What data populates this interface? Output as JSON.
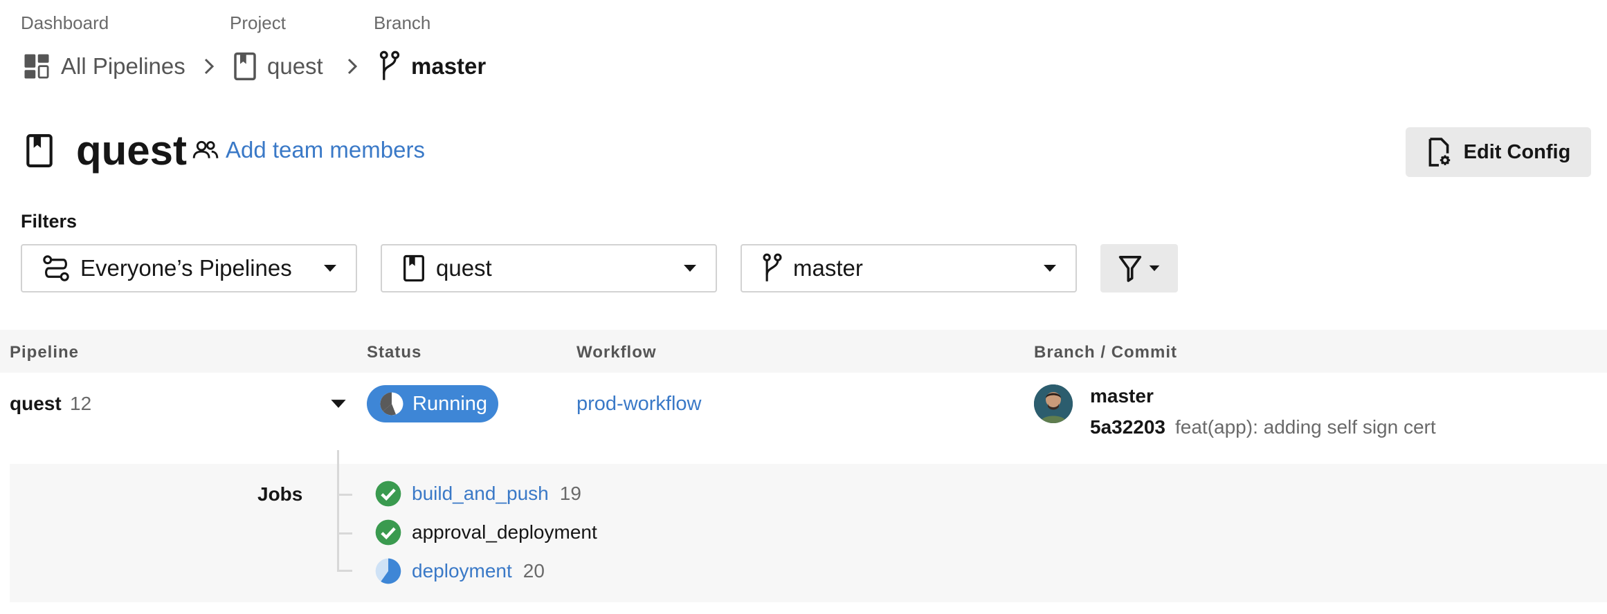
{
  "breadcrumb": {
    "dashboard_label": "Dashboard",
    "project_label": "Project",
    "branch_label": "Branch",
    "all_pipelines": "All Pipelines",
    "project": "quest",
    "branch": "master"
  },
  "header": {
    "title": "quest",
    "add_team": "Add team members",
    "edit_config": "Edit Config"
  },
  "filters": {
    "label": "Filters",
    "pipelines": "Everyone’s Pipelines",
    "project": "quest",
    "branch": "master"
  },
  "table": {
    "columns": [
      "Pipeline",
      "Status",
      "Workflow",
      "Branch / Commit"
    ],
    "row": {
      "pipeline": "quest",
      "number": "12",
      "status": "Running",
      "workflow": "prod-workflow",
      "branch": "master",
      "commit_hash": "5a32203",
      "commit_message": "feat(app): adding self sign cert"
    },
    "jobs_label": "Jobs",
    "jobs": [
      {
        "name": "build_and_push",
        "number": "19",
        "status": "success"
      },
      {
        "name": "approval_deployment",
        "number": "",
        "status": "success"
      },
      {
        "name": "deployment",
        "number": "20",
        "status": "running"
      }
    ]
  },
  "colors": {
    "link": "#3a79c7",
    "running": "#3e86d6",
    "success": "#3a9a4f"
  },
  "icons": [
    "dashboard-icon",
    "project-icon",
    "branch-icon",
    "chevron-right-icon",
    "team-icon",
    "config-file-icon",
    "pipelines-filter-icon",
    "caret-down-icon",
    "filter-funnel-icon",
    "running-icon",
    "check-circle-icon"
  ]
}
